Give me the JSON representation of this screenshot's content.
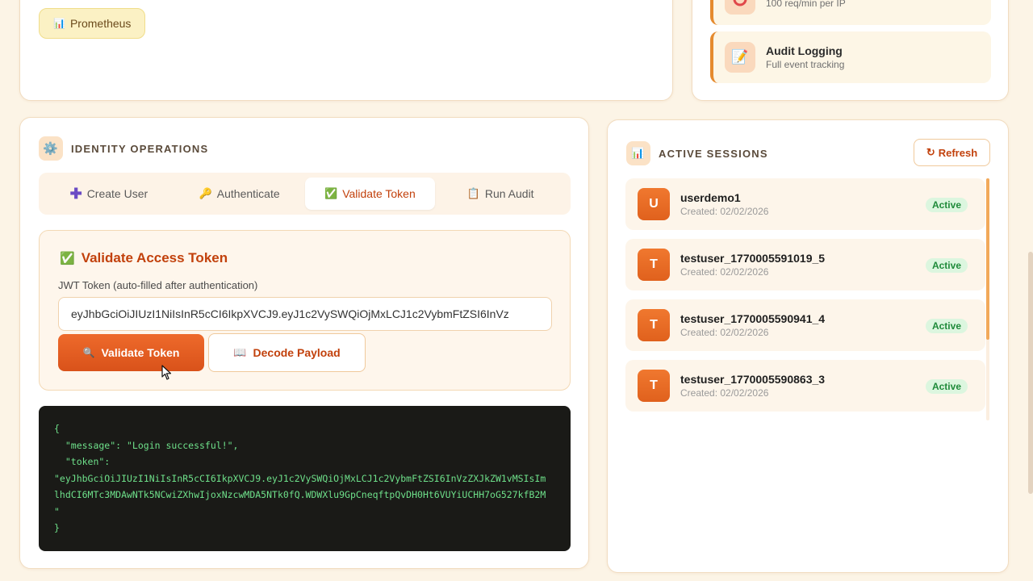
{
  "top_left": {
    "chip_label": "Prometheus",
    "chip_icon": "bar-chart-icon"
  },
  "top_right": {
    "rate_limit_sub": "100 req/min per IP",
    "audit_title": "Audit Logging",
    "audit_sub": "Full event tracking"
  },
  "identity": {
    "heading": "IDENTITY OPERATIONS",
    "tabs": [
      {
        "label": "Create User",
        "icon": "plus-icon"
      },
      {
        "label": "Authenticate",
        "icon": "key-icon"
      },
      {
        "label": "Validate Token",
        "icon": "check-box-icon"
      },
      {
        "label": "Run Audit",
        "icon": "clipboard-icon"
      }
    ],
    "active_tab": "Validate Token",
    "panel_title": "Validate Access Token",
    "field_label": "JWT Token (auto-filled after authentication)",
    "token_value": "eyJhbGciOiJIUzI1NiIsInR5cCI6IkpXVCJ9.eyJ1c2VySWQiOjMxLCJ1c2VybmFtZSI6InVz",
    "validate_button": "Validate Token",
    "decode_button": "Decode Payload",
    "console_lines": [
      "{",
      "  \"message\": \"Login successful!\",",
      "  \"token\":",
      "\"eyJhbGciOiJIUzI1NiIsInR5cCI6IkpXVCJ9.eyJ1c2VySWQiOjMxLCJ1c2VybmFtZSI6InVzZXJkZW1vMSIsIm",
      "lhdCI6MTc3MDAwNTk5NCwiZXhwIjoxNzcwMDA5NTk0fQ.WDWXlu9GpCneqftpQvDH0Ht6VUYiUCHH7oG527kfB2M",
      "\"",
      "}"
    ]
  },
  "sessions": {
    "heading": "ACTIVE SESSIONS",
    "refresh_label": "Refresh",
    "items": [
      {
        "initial": "U",
        "name": "userdemo1",
        "created": "Created: 02/02/2026",
        "status": "Active"
      },
      {
        "initial": "T",
        "name": "testuser_1770005591019_5",
        "created": "Created: 02/02/2026",
        "status": "Active"
      },
      {
        "initial": "T",
        "name": "testuser_1770005590941_4",
        "created": "Created: 02/02/2026",
        "status": "Active"
      },
      {
        "initial": "T",
        "name": "testuser_1770005590863_3",
        "created": "Created: 02/02/2026",
        "status": "Active"
      }
    ]
  },
  "colors": {
    "accent": "#c2410c",
    "primary_button": "#e4581f",
    "status_green": "#1f8a3a",
    "console_bg": "#1a1a17",
    "console_text": "#6ee08a"
  }
}
